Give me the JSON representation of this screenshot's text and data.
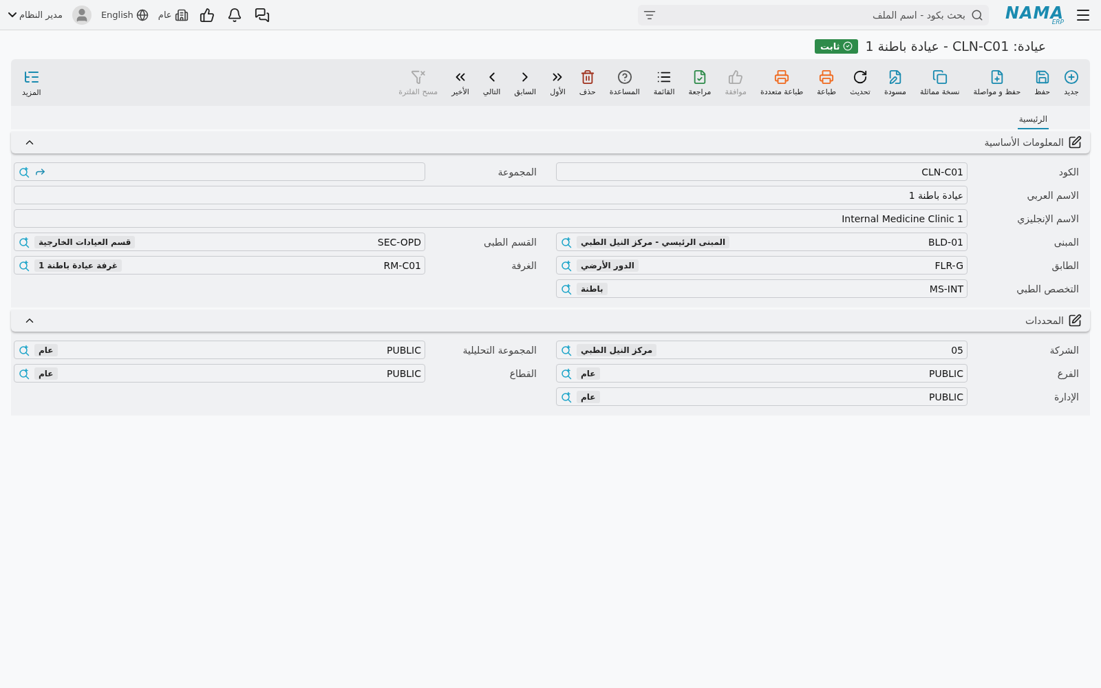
{
  "header": {
    "logo": {
      "main": "NAMA",
      "sub": "ERP"
    },
    "search": {
      "placeholder": "بحث بكود - اسم الملف"
    },
    "company": "عام",
    "language": "English",
    "user": "مدير النظام"
  },
  "title": {
    "text": "عيادة: CLN-C01 - عيادة باطنة 1",
    "status": "ثابت"
  },
  "toolbar": {
    "buttons": [
      {
        "kind": "new",
        "label": "جديد",
        "disabled": false
      },
      {
        "kind": "save",
        "label": "حفظ",
        "disabled": false
      },
      {
        "kind": "save-continue",
        "label": "حفظ و مواصلة",
        "disabled": false
      },
      {
        "kind": "copy",
        "label": "نسخة مماثلة",
        "disabled": false
      },
      {
        "kind": "draft",
        "label": "مسودة",
        "disabled": false
      },
      {
        "kind": "refresh",
        "label": "تحديث",
        "disabled": false
      },
      {
        "kind": "print",
        "label": "طباعة",
        "disabled": false
      },
      {
        "kind": "print-multi",
        "label": "طباعة متعددة",
        "disabled": false
      },
      {
        "kind": "approve",
        "label": "موافقة",
        "disabled": true
      },
      {
        "kind": "review",
        "label": "مراجعة",
        "disabled": false
      },
      {
        "kind": "list",
        "label": "القائمة",
        "disabled": false
      },
      {
        "kind": "help",
        "label": "المساعدة",
        "disabled": false
      },
      {
        "kind": "delete",
        "label": "حذف",
        "disabled": false
      },
      {
        "kind": "first",
        "label": "الأول",
        "disabled": false
      },
      {
        "kind": "prev",
        "label": "السابق",
        "disabled": false
      },
      {
        "kind": "next",
        "label": "التالي",
        "disabled": false
      },
      {
        "kind": "last",
        "label": "الأخير",
        "disabled": false
      },
      {
        "kind": "clear-filter",
        "label": "مسح الفلترة",
        "disabled": true
      }
    ],
    "more": "المزيد"
  },
  "tabs": [
    {
      "label": "الرئيسية",
      "selected": true
    }
  ],
  "sections": [
    {
      "title": "المعلومات الأساسية",
      "expanded": true,
      "rows": [
        [
          {
            "kind": "text",
            "label": "الكود",
            "value": "CLN-C01"
          },
          {
            "kind": "reference",
            "label": "المجموعة"
          }
        ],
        [
          {
            "kind": "wide",
            "label": "الاسم العربي",
            "value": "عيادة باطنة 1"
          }
        ],
        [
          {
            "kind": "wide",
            "label": "الاسم الإنجليزي",
            "value": "Internal Medicine Clinic 1"
          }
        ],
        [
          {
            "kind": "lookup",
            "label": "المبنى",
            "value": "BLD-01",
            "name": "المبنى الرئيسي - مركز النيل الطبي"
          },
          {
            "kind": "lookup",
            "label": "القسم الطبى",
            "value": "SEC-OPD",
            "name": "قسم العيادات الخارجية"
          }
        ],
        [
          {
            "kind": "lookup",
            "label": "الطابق",
            "value": "FLR-G",
            "name": "الدور الأرضي"
          },
          {
            "kind": "lookup",
            "label": "الغرفة",
            "value": "RM-C01",
            "name": "غرفة عيادة باطنة 1"
          }
        ],
        [
          {
            "kind": "lookup",
            "label": "التخصص الطبي",
            "value": "MS-INT",
            "name": "باطنة"
          }
        ]
      ]
    },
    {
      "title": "المحددات",
      "expanded": true,
      "rows": [
        [
          {
            "kind": "lookup",
            "label": "الشركة",
            "value": "05",
            "name": "مركز النيل الطبي"
          },
          {
            "kind": "lookup",
            "label": "المجموعة التحليلية",
            "value": "PUBLIC",
            "name": "عام"
          }
        ],
        [
          {
            "kind": "lookup",
            "label": "الفرع",
            "value": "PUBLIC",
            "name": "عام"
          },
          {
            "kind": "lookup",
            "label": "القطاع",
            "value": "PUBLIC",
            "name": "عام"
          }
        ],
        [
          {
            "kind": "lookup",
            "label": "الإدارة",
            "value": "PUBLIC",
            "name": "عام"
          }
        ]
      ]
    }
  ]
}
